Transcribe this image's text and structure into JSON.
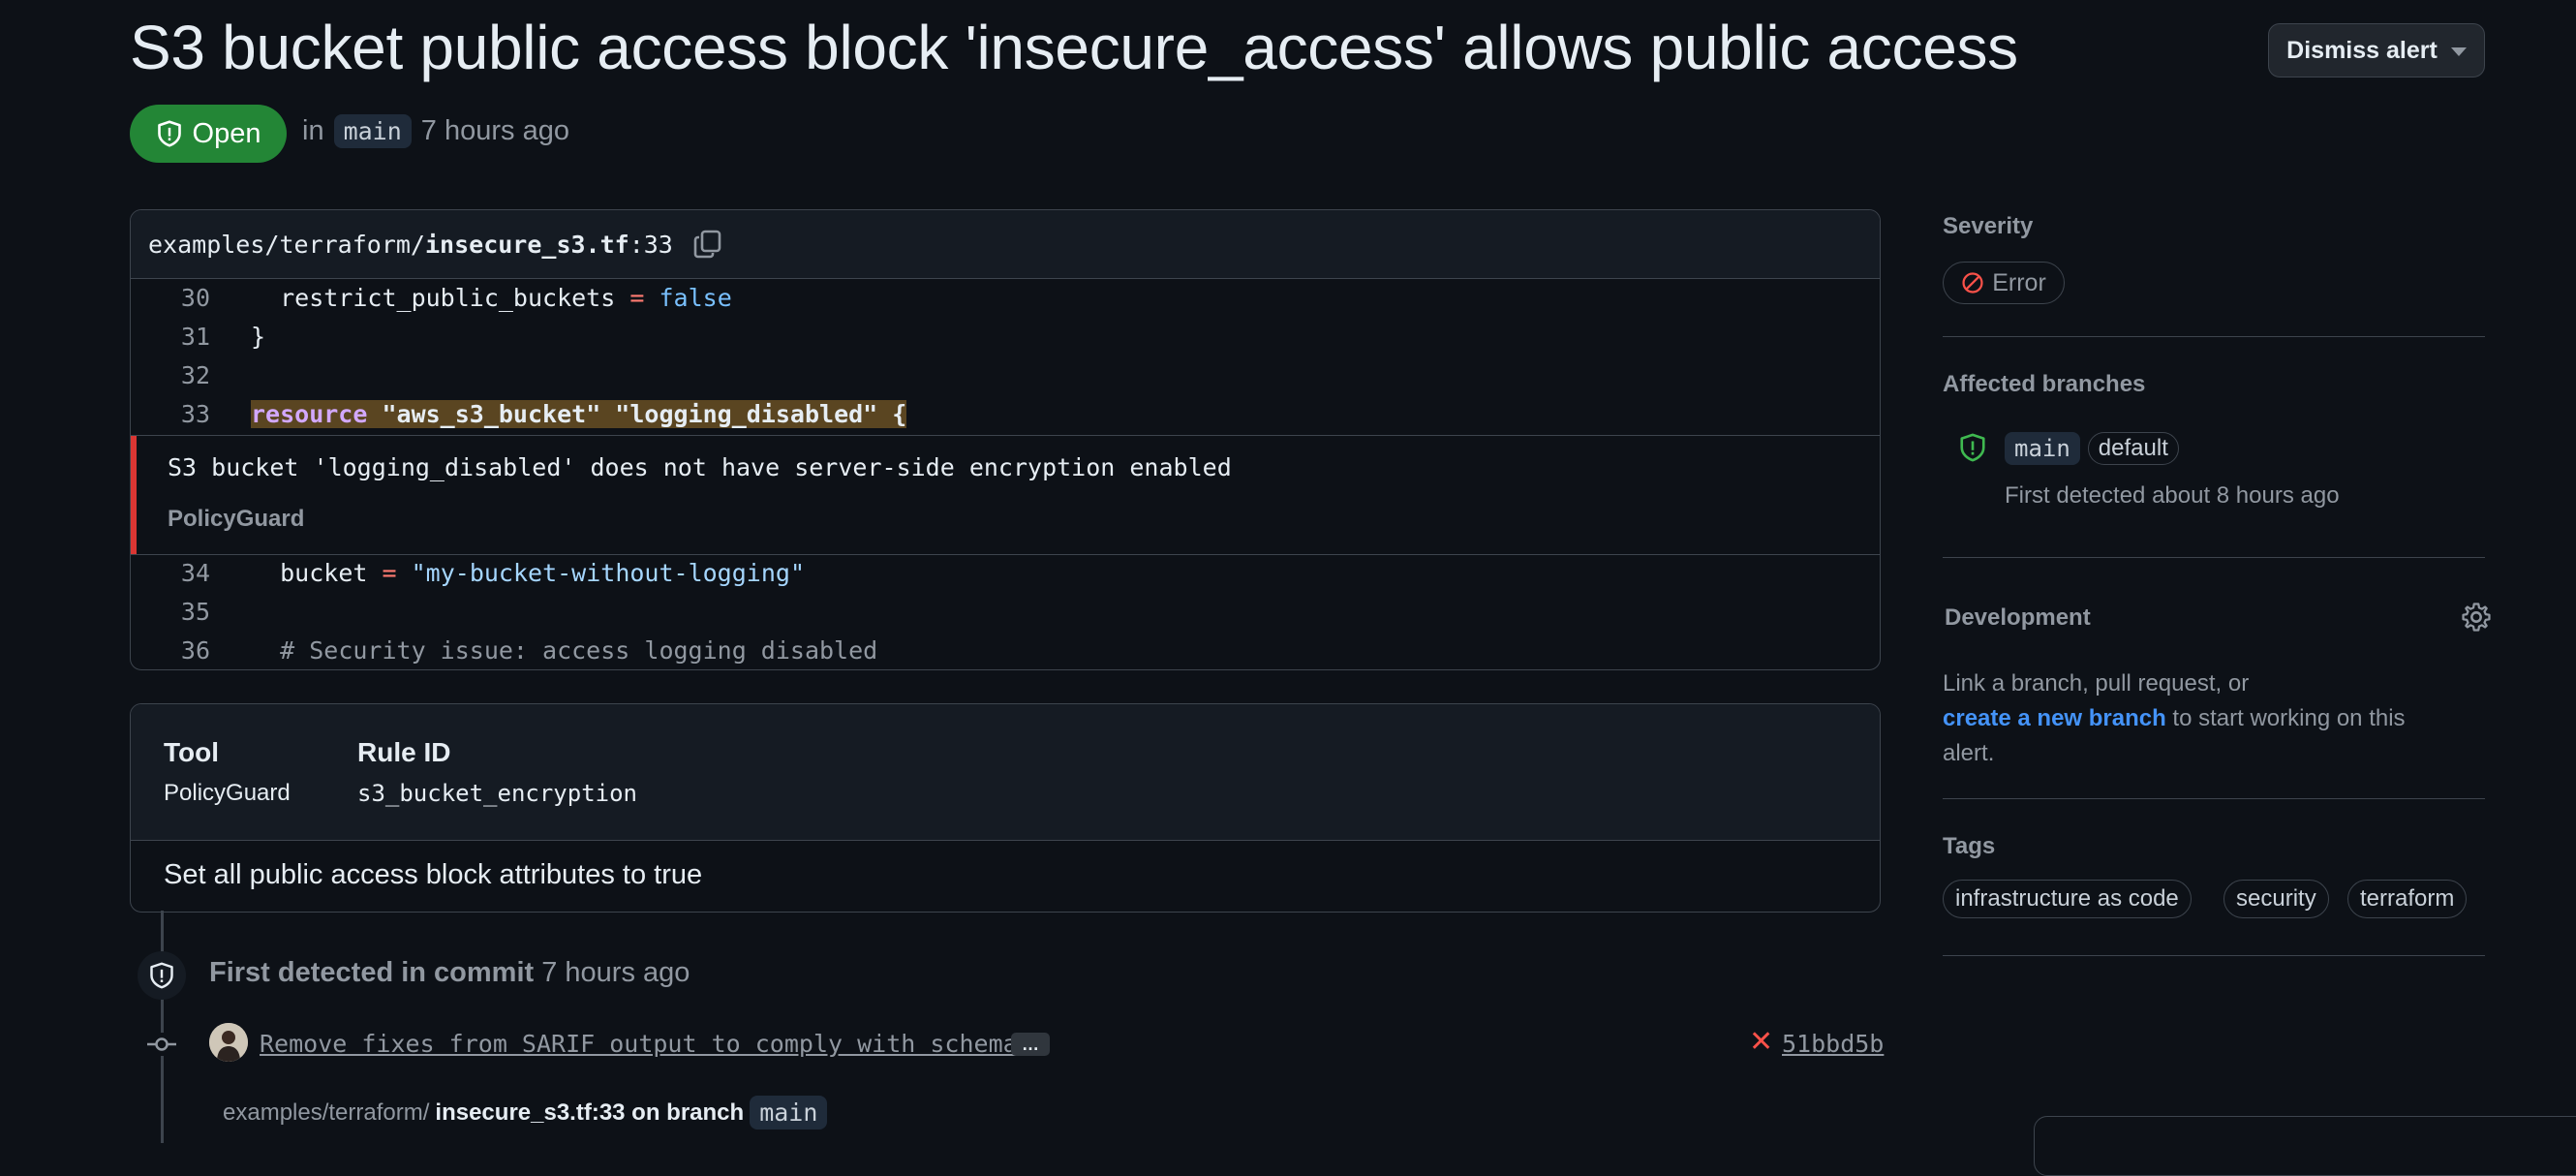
{
  "header": {
    "title": "S3 bucket public access block 'insecure_access' allows public access",
    "dismiss_label": "Dismiss alert",
    "status": "Open",
    "in_label": "in",
    "branch": "main",
    "time": "7 hours ago"
  },
  "code": {
    "path_prefix": "examples/terraform/",
    "file_name": "insecure_s3.tf",
    "line_suffix": ":33",
    "lines_before": [
      {
        "num": "30"
      },
      {
        "num": "31",
        "text": "}"
      },
      {
        "num": "32",
        "text": ""
      },
      {
        "num": "33"
      }
    ],
    "line30": {
      "ident": "restrict_public_buckets",
      "op": "=",
      "value": "false"
    },
    "line33": {
      "kw": "resource",
      "rest": " \"aws_s3_bucket\" \"logging_disabled\" {"
    },
    "alert_message": "S3 bucket 'logging_disabled' does not have server-side encryption enabled",
    "alert_tool": "PolicyGuard",
    "line34": {
      "num": "34",
      "ident": "bucket",
      "op": "=",
      "value": "\"my-bucket-without-logging\""
    },
    "line35": {
      "num": "35"
    },
    "line36": {
      "num": "36",
      "comment": "# Security issue: access logging disabled"
    }
  },
  "tool_box": {
    "tool_header": "Tool",
    "tool_value": "PolicyGuard",
    "rule_header": "Rule ID",
    "rule_value": "s3_bucket_encryption",
    "description": "Set all public access block attributes to true"
  },
  "timeline": {
    "detected_label": "First detected in commit",
    "detected_time": "7 hours ago",
    "commit_message": "Remove fixes from SARIF output to comply with schema",
    "ellipsis": "…",
    "commit_sha": "51bbd5b",
    "path_prefix": "examples/terraform/",
    "path_file": "insecure_s3.tf:33 on branch",
    "branch": "main"
  },
  "sidebar": {
    "severity_label": "Severity",
    "severity_value": "Error",
    "branches_label": "Affected branches",
    "branch_name": "main",
    "branch_badge": "default",
    "branch_detected": "First detected about 8 hours ago",
    "development_label": "Development",
    "dev_text_1": "Link a branch, pull request, or",
    "dev_link": "create a new branch",
    "dev_text_2": " to start working on this",
    "dev_text_3": "alert.",
    "tags_label": "Tags",
    "tags": [
      "infrastructure as code",
      "security",
      "terraform"
    ]
  },
  "colors": {
    "background": "#0d1117",
    "open_green": "#238636",
    "error_red": "#da3633",
    "link_blue": "#4493f8",
    "highlight": "#5a4521"
  }
}
